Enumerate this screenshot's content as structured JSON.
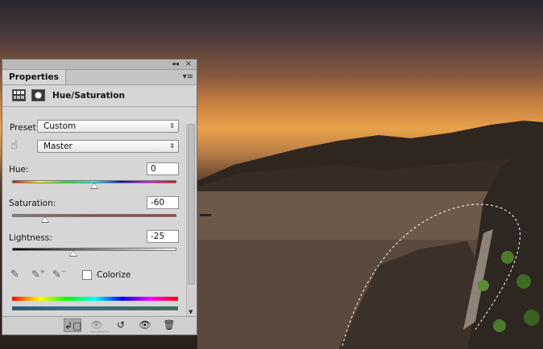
{
  "panel": {
    "tab_label": "Properties",
    "collapse_glyph": "◂◂",
    "close_glyph": "×",
    "menu_glyph": "▾≡",
    "adjustment_title": "Hue/Saturation",
    "adjustment_icon": "hue-saturation-icon",
    "mask_icon": "layer-mask-icon"
  },
  "controls": {
    "preset_label": "Preset:",
    "preset_value": "Custom",
    "channel_value": "Master",
    "hue_label": "Hue:",
    "hue_value": "0",
    "saturation_label": "Saturation:",
    "saturation_value": "-60",
    "lightness_label": "Lightness:",
    "lightness_value": "-25",
    "colorize_label": "Colorize",
    "colorize_checked": false
  },
  "bottom_toolbar": {
    "buttons": [
      "clip-to-layer-icon",
      "view-previous-state-icon",
      "reset-icon",
      "toggle-visibility-icon",
      "delete-icon"
    ]
  }
}
